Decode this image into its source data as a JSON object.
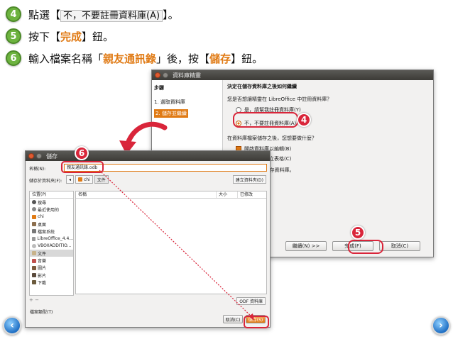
{
  "steps": [
    {
      "num": "4",
      "prefix": "點選【",
      "highlight": "不，不要註冊資料庫(A)",
      "suffix": "】。"
    },
    {
      "num": "5",
      "prefix": "按下【",
      "highlight": "完成",
      "suffix": "】鈕。"
    },
    {
      "num": "6",
      "prefix": "輸入檔案名稱「",
      "highlight": "親友通訊錄",
      "middle": "」後，按【",
      "highlight2": "儲存",
      "suffix": "】鈕。"
    }
  ],
  "wizard": {
    "title": "資料庫精靈",
    "side_header": "步驟",
    "side_items": [
      "1. 選取資料庫",
      "2. 儲存並繼續"
    ],
    "heading": "決定在儲存資料庫之後如何繼續",
    "question1": "您是否想讓精靈在 LibreOffice 中註冊資料庫？",
    "radio_yes": "是，請幫我註冊資料庫(Y)",
    "radio_no": "不，不要註冊資料庫(A)",
    "question2": "在資料庫檔案儲存之後，您想要做什麼？",
    "check1": "開啟資料庫以編輯(B)",
    "check2": "使用精靈建立表格(C)",
    "note": "按一下「完成」，儲存資料庫。",
    "btn_next": "繼續(N) >>",
    "btn_finish": "完成(F)",
    "btn_cancel": "取消(C)"
  },
  "save": {
    "title": "儲存",
    "name_label": "名稱(N):",
    "name_value": "親友通訊錄.odb",
    "folder_label": "儲存於資料夾(F):",
    "path_arrow": "◂",
    "path_home": "chi",
    "path_current": "文件",
    "create_folder": "建立資料夾(D)",
    "places_header": "位置(P)",
    "places": [
      "搜尋",
      "最近使用的",
      "chi",
      "桌面",
      "檔案系統",
      "LibreOffice_4.4...",
      "VBOXADDITIO...",
      "文件",
      "音樂",
      "圖片",
      "影片",
      "下載"
    ],
    "col_name": "名稱",
    "col_size": "大小",
    "col_modified": "已修改",
    "filter": "ODF 資料庫",
    "file_type": "檔案類型(T)",
    "btn_cancel": "取消(C)",
    "btn_save": "儲存(S)",
    "plus_minus": "+  −"
  },
  "badges": {
    "b4": "4",
    "b5": "5",
    "b6": "6"
  },
  "nav": {
    "prev": "‹",
    "next": "›"
  },
  "colors": {
    "step_green": "#6db33f",
    "highlight_orange": "#e07a14",
    "callout_red": "#d9253a",
    "nav_blue": "#1f6fc4"
  }
}
